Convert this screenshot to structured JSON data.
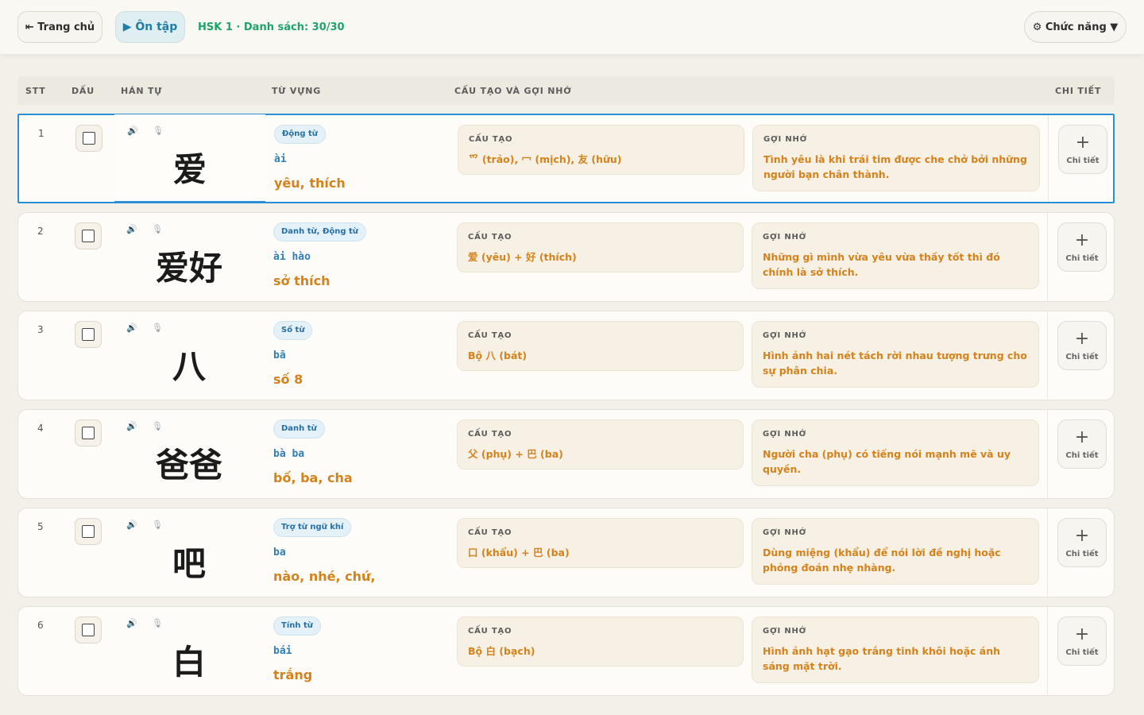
{
  "topbar": {
    "home_label": "⇤ Trang chủ",
    "review_label": "▶ Ôn tập",
    "status": "HSK 1 · Danh sách: 30/30",
    "functions_label": "⚙ Chức năng ▼"
  },
  "table": {
    "headers": {
      "stt": "STT",
      "mark": "DẤU",
      "hanzi": "HÁN TỰ",
      "vocab": "TỪ VỰNG",
      "structure": "CẤU TẠO VÀ GỢI NHỚ",
      "detail": "CHI TIẾT"
    },
    "structure_title": "CẤU TẠO",
    "mnemonic_title": "GỢI NHỚ",
    "detail_label": "Chi tiết",
    "speaker_icon": "🔊",
    "mic_icon": "🎙",
    "rows": [
      {
        "stt": "1",
        "hanzi": "爱",
        "pos": "Động từ",
        "pinyin": "ài",
        "meaning": "yêu, thích",
        "structure": "爫 (trảo), 冖 (mịch), 友 (hữu)",
        "mnemonic": "Tình yêu là khi trái tim được che chở bởi những người bạn chân thành."
      },
      {
        "stt": "2",
        "hanzi": "爱好",
        "pos": "Danh từ, Động từ",
        "pinyin": "ài hào",
        "meaning": "sở thích",
        "structure": "爱 (yêu) + 好 (thích)",
        "mnemonic": "Những gì mình vừa yêu vừa thấy tốt thì đó chính là sở thích."
      },
      {
        "stt": "3",
        "hanzi": "八",
        "pos": "Số từ",
        "pinyin": "bā",
        "meaning": "số 8",
        "structure": "Bộ 八 (bát)",
        "mnemonic": "Hình ảnh hai nét tách rời nhau tượng trưng cho sự phân chia."
      },
      {
        "stt": "4",
        "hanzi": "爸爸",
        "pos": "Danh từ",
        "pinyin": "bà ba",
        "meaning": "bố, ba, cha",
        "structure": "父 (phụ) + 巴 (ba)",
        "mnemonic": "Người cha (phụ) có tiếng nói mạnh mẽ và uy quyền."
      },
      {
        "stt": "5",
        "hanzi": "吧",
        "pos": "Trợ từ ngữ khí",
        "pinyin": "ba",
        "meaning": "nào, nhé, chứ,",
        "structure": "口 (khẩu) + 巴 (ba)",
        "mnemonic": "Dùng miệng (khẩu) để nói lời đề nghị hoặc phỏng đoán nhẹ nhàng."
      },
      {
        "stt": "6",
        "hanzi": "白",
        "pos": "Tính từ",
        "pinyin": "bái",
        "meaning": "trắng",
        "structure": "Bộ 白 (bạch)",
        "mnemonic": "Hình ảnh hạt gạo trắng tinh khôi hoặc ánh sáng mặt trời."
      }
    ]
  }
}
